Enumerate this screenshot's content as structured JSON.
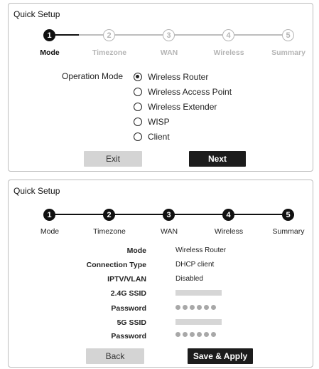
{
  "setup_step1": {
    "title": "Quick Setup",
    "steps": [
      {
        "num": "1",
        "label": "Mode"
      },
      {
        "num": "2",
        "label": "Timezone"
      },
      {
        "num": "3",
        "label": "WAN"
      },
      {
        "num": "4",
        "label": "Wireless"
      },
      {
        "num": "5",
        "label": "Summary"
      }
    ],
    "current_step": 1,
    "operation_mode_label": "Operation Mode",
    "options": [
      {
        "label": "Wireless Router",
        "checked": true
      },
      {
        "label": "Wireless Access Point",
        "checked": false
      },
      {
        "label": "Wireless Extender",
        "checked": false
      },
      {
        "label": "WISP",
        "checked": false
      },
      {
        "label": "Client",
        "checked": false
      }
    ],
    "exit_label": "Exit",
    "next_label": "Next"
  },
  "setup_summary": {
    "title": "Quick Setup",
    "steps": [
      {
        "num": "1",
        "label": "Mode"
      },
      {
        "num": "2",
        "label": "Timezone"
      },
      {
        "num": "3",
        "label": "WAN"
      },
      {
        "num": "4",
        "label": "Wireless"
      },
      {
        "num": "5",
        "label": "Summary"
      }
    ],
    "current_step": 5,
    "summary": {
      "mode_label": "Mode",
      "mode_value": "Wireless Router",
      "connection_label": "Connection Type",
      "connection_value": "DHCP client",
      "iptv_label": "IPTV/VLAN",
      "iptv_value": "Disabled",
      "ssid24_label": "2.4G SSID",
      "password24_label": "Password",
      "ssid5_label": "5G SSID",
      "password5_label": "Password"
    },
    "back_label": "Back",
    "apply_label": "Save & Apply"
  },
  "colors": {
    "active": "#111111",
    "inactive": "#b5b5b5",
    "button_dark": "#1c1c1c",
    "button_grey": "#d4d4d4",
    "masked_bar": "#d6d6d6",
    "masked_dot": "#a8a8a8"
  }
}
